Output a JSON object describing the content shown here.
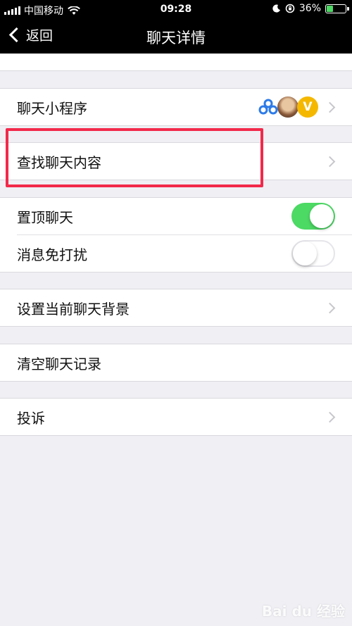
{
  "status_bar": {
    "carrier": "中国移动",
    "time": "09:28",
    "battery_percent": "36%",
    "battery_level": 0.36
  },
  "nav": {
    "back_label": "返回",
    "title": "聊天详情"
  },
  "rows": {
    "mini_programs": {
      "label": "聊天小程序",
      "badge_letter": "V"
    },
    "search_content": {
      "label": "查找聊天内容"
    },
    "pin_chat": {
      "label": "置顶聊天",
      "enabled": true
    },
    "mute": {
      "label": "消息免打扰",
      "enabled": false
    },
    "set_background": {
      "label": "设置当前聊天背景"
    },
    "clear_history": {
      "label": "清空聊天记录"
    },
    "report": {
      "label": "投诉"
    }
  },
  "watermark": "Bai du 经验",
  "colors": {
    "toggle_on": "#4cd964",
    "highlight_box": "#f2294a",
    "background": "#efeff4"
  }
}
